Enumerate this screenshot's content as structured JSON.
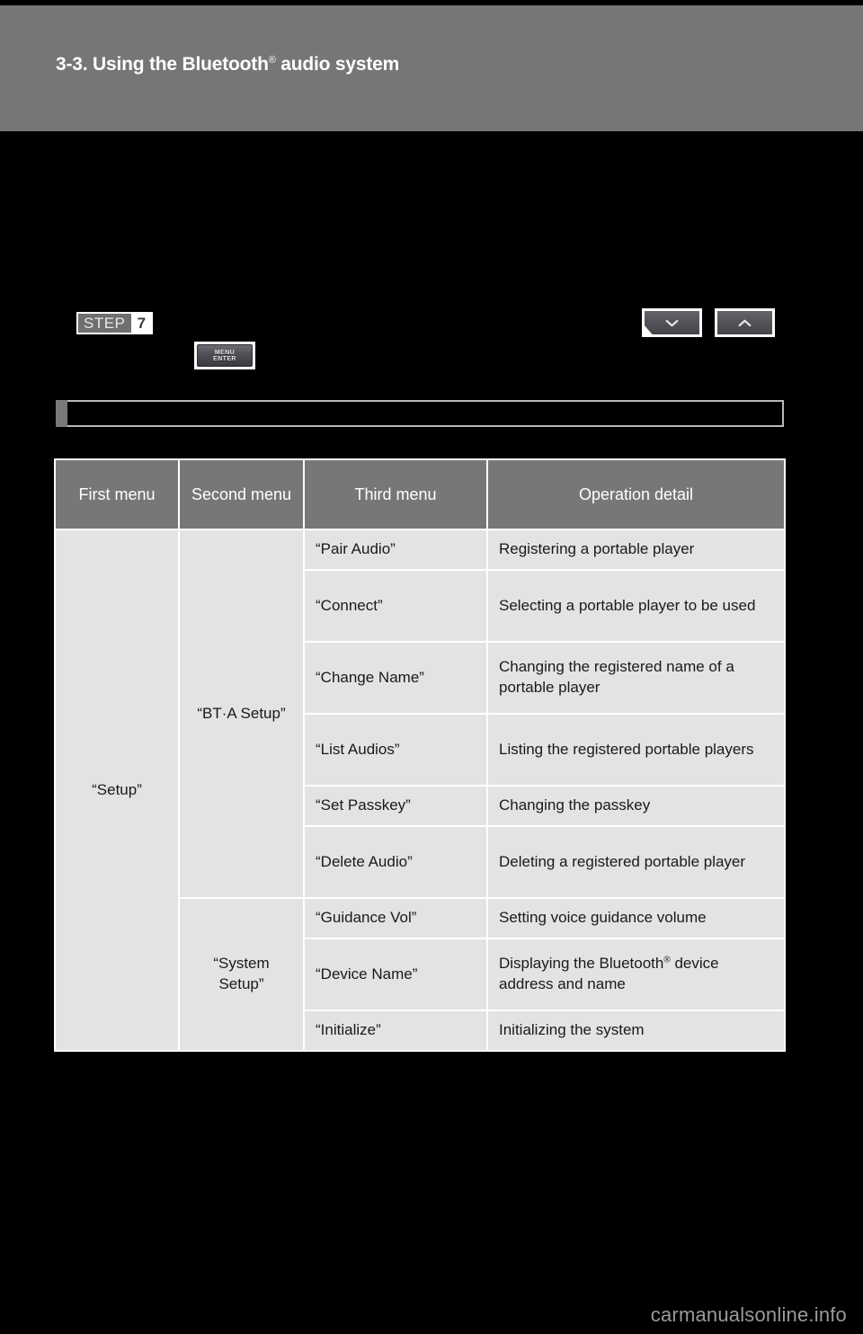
{
  "header": {
    "section_number": "3-3.",
    "title_prefix": "3-3. Using the Bluetooth",
    "registered_mark": "®",
    "title_suffix": " audio system",
    "band_color": "#767676"
  },
  "step": {
    "label": "STEP",
    "number": "7",
    "menu_key_line1": "MENU",
    "menu_key_line2": "ENTER",
    "arrow_down_name": "seek-down-key",
    "arrow_up_name": "seek-up-key"
  },
  "table": {
    "headers": [
      "First menu",
      "Second menu",
      "Third menu",
      "Operation detail"
    ],
    "first_menu": "“Setup”",
    "groups": [
      {
        "second_menu": "“BT·A Setup”",
        "rows": [
          {
            "third_menu": "“Pair Audio”",
            "detail": "Registering a portable player",
            "lines": 1
          },
          {
            "third_menu": "“Connect”",
            "detail": "Selecting a portable player to be used",
            "lines": 2
          },
          {
            "third_menu": "“Change Name”",
            "detail": "Changing the registered name of a portable player",
            "lines": 2
          },
          {
            "third_menu": "“List Audios”",
            "detail": "Listing the registered portable players",
            "lines": 2
          },
          {
            "third_menu": "“Set Passkey”",
            "detail": "Changing the passkey",
            "lines": 1
          },
          {
            "third_menu": "“Delete Audio”",
            "detail": "Deleting a registered portable player",
            "lines": 2
          }
        ]
      },
      {
        "second_menu": "“System Setup”",
        "rows": [
          {
            "third_menu": "“Guidance Vol”",
            "detail": "Setting voice guidance volume",
            "lines": 1
          },
          {
            "third_menu": "“Device Name”",
            "detail": "Displaying the Bluetooth",
            "detail_sup": "®",
            "detail_tail": " device address and name",
            "lines": 2
          },
          {
            "third_menu": "“Initialize”",
            "detail": "Initializing the system",
            "lines": 1
          }
        ]
      }
    ]
  },
  "watermark": {
    "text": "carmanualsonline.info"
  },
  "colors": {
    "page_background": "#000000",
    "header_band": "#767676",
    "table_header": "#777777",
    "table_cell": "#e3e3e3",
    "grid_line": "#ffffff",
    "watermark": "#9a9a9a"
  }
}
